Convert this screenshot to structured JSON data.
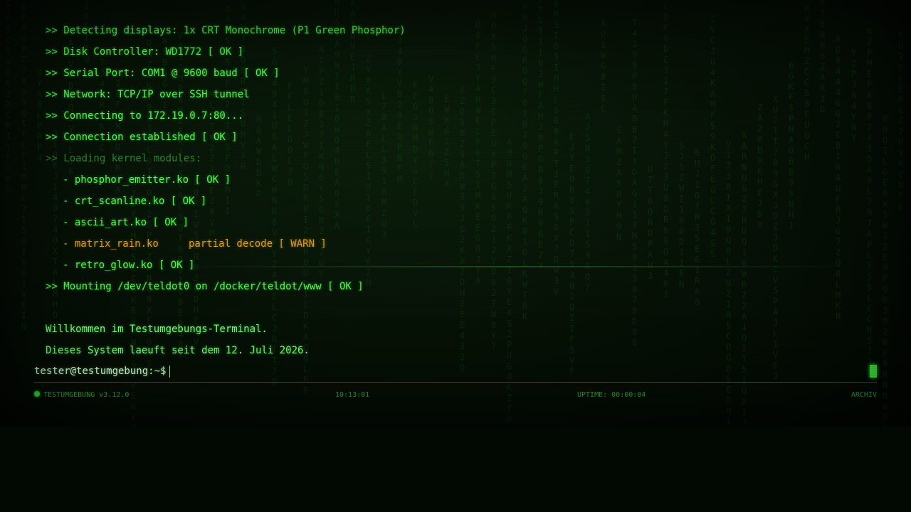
{
  "terminal": {
    "lines": [
      {
        "text": ">> Detecting displays: 1x CRT Monochrome (P1 Green Phosphor)",
        "kind": "info"
      },
      {
        "text": ">> Disk Controller: WD1772 [ OK ]",
        "kind": "info"
      },
      {
        "text": ">> Serial Port: COM1 @ 9600 baud [ OK ]",
        "kind": "info"
      },
      {
        "text": ">> Network: TCP/IP over SSH tunnel",
        "kind": "info"
      },
      {
        "text": ">> Connecting to 172.19.0.7:80...",
        "kind": "info"
      },
      {
        "text": ">> Connection established [ OK ]",
        "kind": "info"
      },
      {
        "text": ">> Loading kernel modules:",
        "kind": "dim"
      },
      {
        "text": "- phosphor_emitter.ko [ OK ]",
        "kind": "sub"
      },
      {
        "text": "- crt_scanline.ko [ OK ]",
        "kind": "sub"
      },
      {
        "text": "- ascii_art.ko [ OK ]",
        "kind": "sub"
      },
      {
        "text": "- matrix_rain.ko     partial decode [ WARN ]",
        "kind": "sub-warn"
      },
      {
        "text": "- retro_glow.ko [ OK ]",
        "kind": "sub"
      },
      {
        "text": ">> Mounting /dev/teldot0 on /docker/teldot/www [ OK ]",
        "kind": "info"
      },
      {
        "text": "",
        "kind": "blank"
      },
      {
        "text": "Willkommen im Testumgebungs-Terminal.",
        "kind": "msg"
      },
      {
        "text": "Dieses System laeuft seit dem 12. Juli 2026.",
        "kind": "msg"
      }
    ],
    "prompt": "tester@testumgebung:~$",
    "input_value": ""
  },
  "status_bar": {
    "app_name": "TESTUMGEBUNG v3.12.0",
    "clock": "10:13:01",
    "uptime": "UPTIME: 00:00:04",
    "archive_label": "ARCHIV"
  },
  "colors": {
    "phosphor": "#55ff55",
    "warn": "#e0a020",
    "background": "#020802"
  }
}
